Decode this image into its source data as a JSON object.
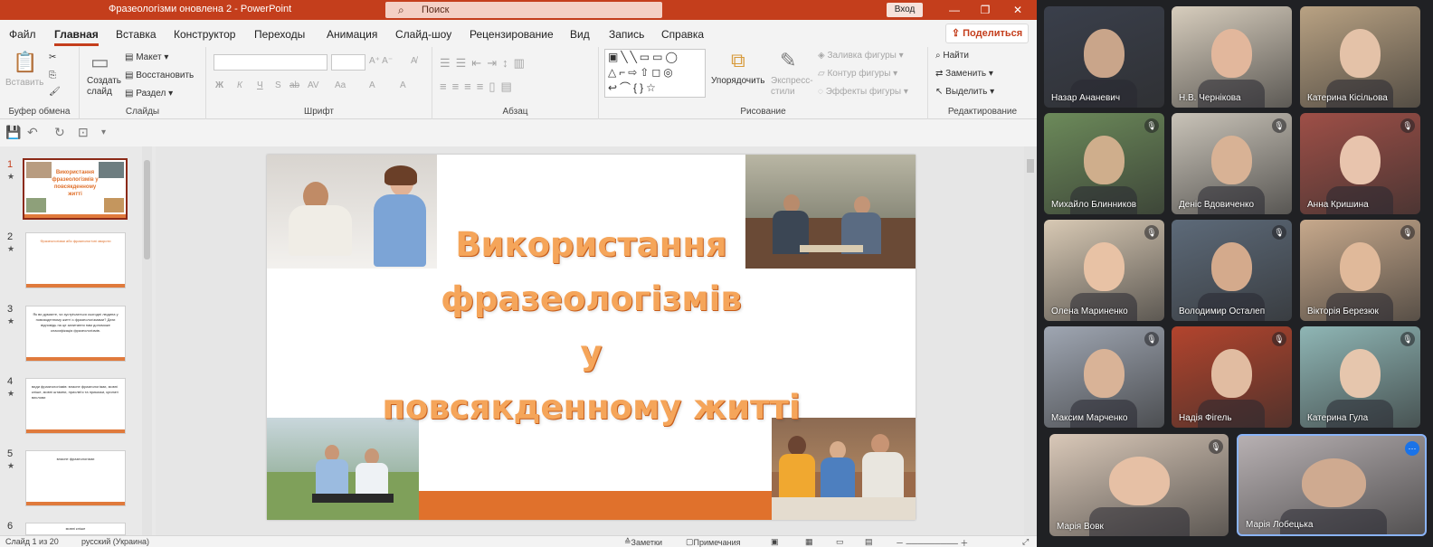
{
  "window": {
    "title": "Фразеологізми оновлена 2  -  PowerPoint",
    "search_placeholder": "Поиск",
    "login": "Вход",
    "controls": [
      "—",
      "❐",
      "✕"
    ]
  },
  "menu": {
    "tabs": [
      "Файл",
      "Главная",
      "Вставка",
      "Конструктор",
      "Переходы",
      "Анимация",
      "Слайд-шоу",
      "Рецензирование",
      "Вид",
      "Запись",
      "Справка"
    ],
    "active": "Главная",
    "share": "Поделиться"
  },
  "ribbon": {
    "clipboard": {
      "paste": "Вставить",
      "label": "Буфер обмена"
    },
    "slides": {
      "new_slide": "Создать\nслайд",
      "layout": "Макет",
      "reset": "Восстановить",
      "section": "Раздел",
      "label": "Слайды"
    },
    "font": {
      "label": "Шрифт",
      "buttons": [
        "Ж",
        "К",
        "Ч",
        "S",
        "ab",
        "AV",
        "Aa",
        "A",
        "A"
      ]
    },
    "paragraph": {
      "label": "Абзац"
    },
    "drawing": {
      "arrange": "Упорядочить",
      "quick_styles": "Экспресс-\nстили",
      "fill": "Заливка фигуры",
      "outline": "Контур фигуры",
      "effects": "Эффекты фигуры",
      "label": "Рисование"
    },
    "editing": {
      "find": "Найти",
      "replace": "Заменить",
      "select": "Выделить",
      "label": "Редактирование"
    }
  },
  "thumbnails": [
    {
      "num": "1",
      "text": "Використання фразеологізмів у повсякденному житті"
    },
    {
      "num": "2",
      "text": "Фразеологізми або фразеологічні звороти"
    },
    {
      "num": "3",
      "text": "Як ви думаєте, чи зустрічається сьогодні людина у повсякденному житті з фразеологізмами? Дати відповідь на це запитання нам допоможе класифікація фразеологізмів."
    },
    {
      "num": "4",
      "text": "види фразеологізмів: власне фразеологізми, мовні кліше, мовні штампи, прислів'я та приказки, крилаті вислови"
    },
    {
      "num": "5",
      "text": "власне фразеологізми"
    },
    {
      "num": "6",
      "text": "мовні кліше"
    }
  ],
  "slide": {
    "title_lines": [
      "Використання",
      "фразеологізмів",
      "у",
      "повсякденному житті"
    ]
  },
  "statusbar": {
    "slide_info": "Слайд 1 из 20",
    "language": "русский (Украина)",
    "notes": "Заметки",
    "comments": "Примечания"
  },
  "participants": [
    {
      "name": "Назар Ананевич",
      "muted": false,
      "bg": "#3a3f4b",
      "skin": "#c9a58a"
    },
    {
      "name": "Н.В. Чернікова",
      "muted": false,
      "bg": "#d7cdbd",
      "skin": "#e2b79c"
    },
    {
      "name": "Катерина Кісільова",
      "muted": false,
      "bg": "#b9a283",
      "skin": "#e4c2a8"
    },
    {
      "name": "Михайло Блинников",
      "muted": true,
      "bg": "#6c8a5a",
      "skin": "#cfae8c"
    },
    {
      "name": "Деніс Вдовиченко",
      "muted": true,
      "bg": "#c9c3b8",
      "skin": "#d8b295"
    },
    {
      "name": "Анна Кришина",
      "muted": true,
      "bg": "#9e4f47",
      "skin": "#e8c4ad"
    },
    {
      "name": "Олена Мариненко",
      "muted": true,
      "bg": "#d8c9b4",
      "skin": "#e8c2a5"
    },
    {
      "name": "Володимир Осталеп",
      "muted": true,
      "bg": "#5d6a79",
      "skin": "#d4aa8c"
    },
    {
      "name": "Вікторія Березюк",
      "muted": true,
      "bg": "#c7a98c",
      "skin": "#e0b99a"
    },
    {
      "name": "Максим Марченко",
      "muted": true,
      "bg": "#9fa6b2",
      "skin": "#d9b397"
    },
    {
      "name": "Надія Фігель",
      "muted": true,
      "bg": "#b3442d",
      "skin": "#e1bca1"
    },
    {
      "name": "Катерина Гула",
      "muted": true,
      "bg": "#8fb6b5",
      "skin": "#e6c6ad"
    },
    {
      "name": "Марія Вовк",
      "muted": true,
      "bg": "#d9c8b8",
      "skin": "#e6c0a5"
    },
    {
      "name": "Марія Лобецька",
      "muted": false,
      "bg": "#b7b0b2",
      "skin": "#cfaa90"
    }
  ],
  "colors": {
    "ppt_accent": "#c43e1c",
    "title_orange": "#f5a55a",
    "slide_bar": "#e0712c",
    "meet_bg": "#202124",
    "active_speaker": "#8ab4f8"
  }
}
